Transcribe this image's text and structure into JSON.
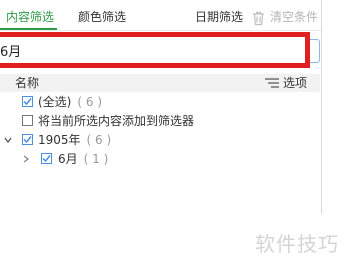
{
  "tabs": [
    {
      "label": "内容筛选"
    },
    {
      "label": "颜色筛选"
    },
    {
      "label": "日期筛选"
    }
  ],
  "clear_label": "清空条件",
  "search": {
    "value": "6月"
  },
  "list_header": {
    "name_label": "名称",
    "options_label": "选项"
  },
  "items": [
    {
      "label": "(全选)",
      "count": "( 6 )",
      "checked": true
    },
    {
      "label": "将当前所选内容添加到筛选器",
      "count": "",
      "checked": false
    },
    {
      "label": "1905年",
      "count": "( 6 )",
      "checked": true,
      "expanded": true
    },
    {
      "label": "6月",
      "count": "( 1 )",
      "checked": true,
      "expanded": false
    }
  ],
  "watermark": "软件技巧",
  "colors": {
    "accent": "#2e9a45",
    "highlight": "#e02020",
    "checkbox_check": "#4a90e2"
  }
}
